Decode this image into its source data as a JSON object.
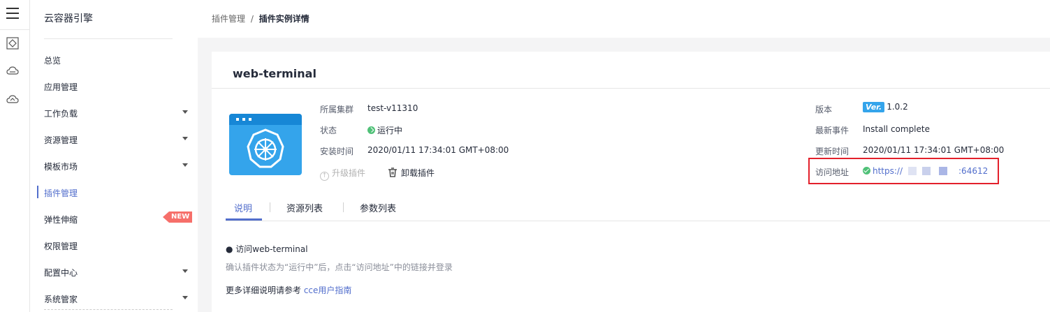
{
  "sidebar": {
    "title": "云容器引擎",
    "items": [
      {
        "label": "总览",
        "caret": false
      },
      {
        "label": "应用管理",
        "caret": false
      },
      {
        "label": "工作负载",
        "caret": true
      },
      {
        "label": "资源管理",
        "caret": true
      },
      {
        "label": "模板市场",
        "caret": true
      },
      {
        "label": "插件管理",
        "caret": false,
        "active": true
      },
      {
        "label": "弹性伸缩",
        "caret": false,
        "badge": "NEW"
      },
      {
        "label": "权限管理",
        "caret": false
      },
      {
        "label": "配置中心",
        "caret": true
      },
      {
        "label": "系统管家",
        "caret": true
      }
    ]
  },
  "breadcrumb": {
    "parent": "插件管理",
    "separator": "/",
    "current": "插件实例详情"
  },
  "plugin": {
    "name": "web-terminal",
    "cluster_label": "所属集群",
    "cluster": "test-v11310",
    "status_label": "状态",
    "status": "运行中",
    "install_time_label": "安装时间",
    "install_time": "2020/01/11 17:34:01 GMT+08:00",
    "version_label": "版本",
    "version_badge": "Ver.",
    "version": "1.0.2",
    "event_label": "最新事件",
    "event": "Install complete",
    "update_time_label": "更新时间",
    "update_time": "2020/01/11 17:34:01 GMT+08:00",
    "access_label": "访问地址",
    "access_url_prefix": "https://",
    "access_url_suffix": ":64612"
  },
  "actions": {
    "upgrade": "升级插件",
    "uninstall": "卸载插件"
  },
  "tabs": [
    "说明",
    "资源列表",
    "参数列表"
  ],
  "doc": {
    "heading": "● 访问web-terminal",
    "note": "确认插件状态为“运行中”后，点击“访问地址”中的链接并登录",
    "more_prefix": "更多详细说明请参考 ",
    "more_link": "cce用户指南"
  },
  "colors": {
    "accent": "#526ecc",
    "status_ok": "#50c178",
    "badge_new": "#f66f6a",
    "highlight_box": "#e3202b"
  }
}
